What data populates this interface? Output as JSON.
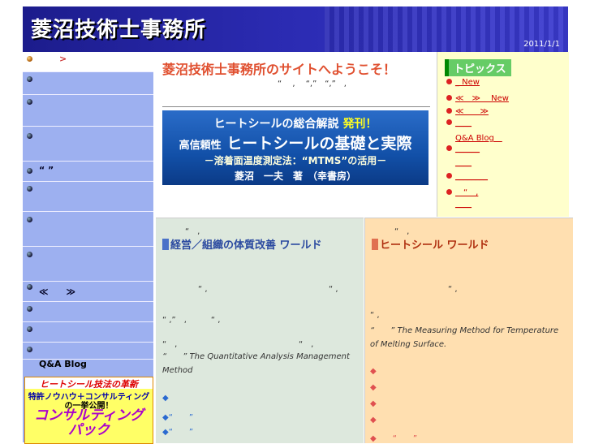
{
  "header": {
    "title": "菱沼技術士事務所",
    "date": "2011/1/1"
  },
  "sidebar": {
    "items": [
      {
        "label": ">"
      },
      {
        "label": ""
      },
      {
        "label": ""
      },
      {
        "label": ""
      },
      {
        "label": "“ ”"
      },
      {
        "label": ""
      },
      {
        "label": ""
      },
      {
        "label": ""
      },
      {
        "label": "≪　　≫"
      },
      {
        "label": ""
      },
      {
        "label": ""
      },
      {
        "label": ""
      }
    ],
    "qa_blog": "Q&A Blog",
    "banner": {
      "line1": "ヒートシール技法の革新",
      "line2a": "特許ノウハウ",
      "line2b": "＋コンサルティング",
      "line3": "の一挙公開！",
      "line4": "コンサルティング",
      "line5": "パック"
    }
  },
  "main": {
    "welcome": "菱沼技術士事務所のサイトへようこそ！",
    "marks": "“　 ,　 “,”　“,”　,",
    "book": {
      "l1a": "ヒートシールの総合解説",
      "l1b": "発刊！",
      "l2a": "高信頼性",
      "l2b": "ヒートシールの基礎と実際",
      "l3": "－溶着面温度測定法：“MTMS”の活用－",
      "l4": "菱沼　一夫　著　（幸書房）"
    }
  },
  "topics": {
    "title": "トピックス",
    "items": [
      {
        "text": "_ New"
      },
      {
        "text": "≪　≫　 New"
      },
      {
        "text": "≪　　≫"
      },
      {
        "text": "____"
      },
      {
        "text": "Q&A Blog　"
      },
      {
        "text": "______"
      },
      {
        "text": "____"
      },
      {
        "text": "________"
      },
      {
        "text": "　“　,"
      },
      {
        "text": "____"
      }
    ]
  },
  "left_col": {
    "top_marks": "“　,",
    "title": "経営／組織の体質改善 ワールド",
    "m1": "“ ,",
    "m1b": "“ ,",
    "m2": "“ ,”　,　　　“ ,",
    "m3": "“　,",
    "m3b": "“　,",
    "desc": "“　　” The Quantitative Analysis Management Method",
    "d1": "◆",
    "d2": "◆“　　”",
    "d3": "◆“　　”"
  },
  "right_col": {
    "top_marks": "“　,",
    "title": "ヒートシール ワールド",
    "m1": "“ ,",
    "m2": "“ ,",
    "desc": "“　　” The Measuring Method for Temperature of Melting Surface.",
    "d1": "◆",
    "d2": "◆",
    "d3": "◆",
    "d4": "◆",
    "d5": "◆　　“　　”"
  }
}
